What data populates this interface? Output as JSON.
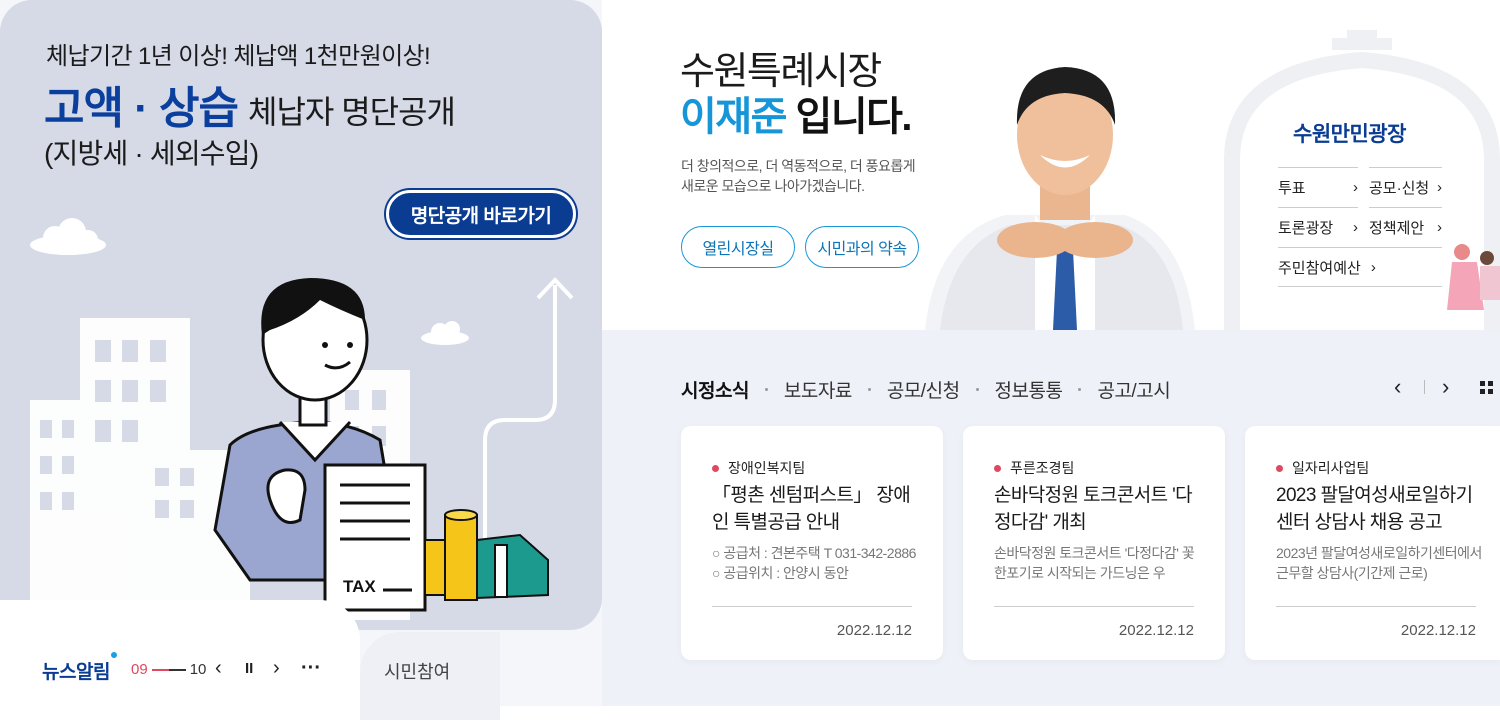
{
  "banner": {
    "line1": "체납기간 1년 이상! 체납액 1천만원이상!",
    "big": "고액 · 상습",
    "rest": "체납자 명단공개",
    "line3": "(지방세 · 세외수입)",
    "button": "명단공개 바로가기",
    "tax_label": "TAX"
  },
  "news_bar": {
    "title": "뉴스알림",
    "current": "09",
    "total": "10",
    "prev": "‹",
    "pause": "II",
    "next": "›",
    "more": "···",
    "civic_tab": "시민참여"
  },
  "mayor": {
    "line1": "수원특례시장",
    "name": "이재준",
    "suffix": " 입니다.",
    "desc1": "더 창의적으로, 더 역동적으로, 더 풍요롭게",
    "desc2": "새로운 모습으로 나아가겠습니다.",
    "btn1": "열린시장실",
    "btn2": "시민과의 약속"
  },
  "plaza": {
    "title": "수원만민광장",
    "links": [
      {
        "label": "투표"
      },
      {
        "label": "공모·신청"
      },
      {
        "label": "토론광장"
      },
      {
        "label": "정책제안"
      },
      {
        "label": "주민참여예산"
      }
    ],
    "chevron": "›"
  },
  "news": {
    "tabs": [
      {
        "label": "시정소식",
        "active": true
      },
      {
        "label": "보도자료",
        "active": false
      },
      {
        "label": "공모/신청",
        "active": false
      },
      {
        "label": "정보통통",
        "active": false
      },
      {
        "label": "공고/고시",
        "active": false
      }
    ],
    "prev": "‹",
    "next": "›",
    "cards": [
      {
        "team": "장애인복지팀",
        "title": "「평촌 센텀퍼스트」 장애인 특별공급 안내",
        "summary": "○ 공급처 : 견본주택 T 031-342-2886   ○ 공급위치 : 안양시 동안",
        "date": "2022.12.12"
      },
      {
        "team": "푸른조경팀",
        "title": "손바닥정원 토크콘서트 '다정다감' 개최",
        "summary": "손바닥정원 토크콘서트 '다정다감' 꽃 한포기로 시작되는 가드닝은 우",
        "date": "2022.12.12"
      },
      {
        "team": "일자리사업팀",
        "title": "2023 팔달여성새로일하기센터 상담사 채용 공고",
        "summary": "2023년 팔달여성새로일하기센터에서 근무할 상담사(기간제 근로)",
        "date": "2022.12.12"
      }
    ]
  }
}
